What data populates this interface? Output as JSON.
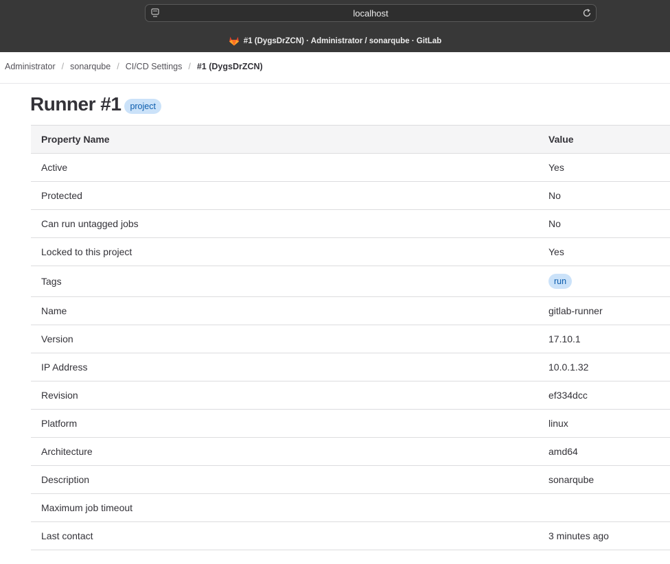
{
  "browser": {
    "url": "localhost",
    "tab_title": "#1 (DygsDrZCN) · Administrator / sonarqube · GitLab"
  },
  "breadcrumb": [
    {
      "label": "Administrator"
    },
    {
      "label": "sonarqube"
    },
    {
      "label": "CI/CD Settings"
    },
    {
      "label": "#1 (DygsDrZCN)"
    }
  ],
  "page": {
    "title": "Runner #1",
    "badge": "project"
  },
  "table": {
    "headers": {
      "name": "Property Name",
      "value": "Value"
    },
    "rows": [
      {
        "name": "Active",
        "value": "Yes"
      },
      {
        "name": "Protected",
        "value": "No"
      },
      {
        "name": "Can run untagged jobs",
        "value": "No"
      },
      {
        "name": "Locked to this project",
        "value": "Yes"
      },
      {
        "name": "Tags",
        "value": "run"
      },
      {
        "name": "Name",
        "value": "gitlab-runner"
      },
      {
        "name": "Version",
        "value": "17.10.1"
      },
      {
        "name": "IP Address",
        "value": "10.0.1.32"
      },
      {
        "name": "Revision",
        "value": "ef334dcc"
      },
      {
        "name": "Platform",
        "value": "linux"
      },
      {
        "name": "Architecture",
        "value": "amd64"
      },
      {
        "name": "Description",
        "value": "sonarqube"
      },
      {
        "name": "Maximum job timeout",
        "value": ""
      },
      {
        "name": "Last contact",
        "value": "3 minutes ago"
      }
    ]
  },
  "colors": {
    "badge_bg": "#cbe2f9",
    "badge_text": "#0b5cad",
    "chrome_bg": "#383838"
  }
}
